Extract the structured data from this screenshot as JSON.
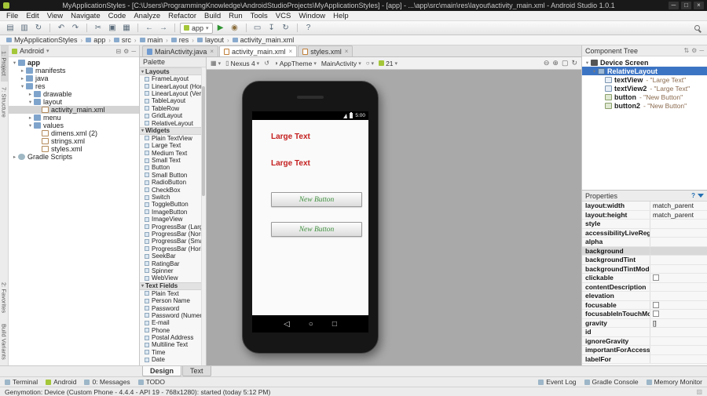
{
  "colors": {
    "accent": "#3c74c4",
    "selection-unfocused": "#d4d4d4",
    "preview-text": "#c41e1e",
    "preview-button-text": "#3f8f3f",
    "canvas": "#a9a9a9"
  },
  "window": {
    "title": "MyApplicationStyles - [C:\\Users\\ProgrammingKnowledge\\AndroidStudioProjects\\MyApplicationStyles] - [app] - ...\\app\\src\\main\\res\\layout\\activity_main.xml - Android Studio 1.0.1"
  },
  "menu_bar": [
    "File",
    "Edit",
    "View",
    "Navigate",
    "Code",
    "Analyze",
    "Refactor",
    "Build",
    "Run",
    "Tools",
    "VCS",
    "Window",
    "Help"
  ],
  "toolbar": {
    "run_config": "app",
    "icons": [
      "open",
      "save",
      "sync",
      "sep",
      "undo",
      "redo",
      "sep",
      "cut",
      "copy",
      "paste",
      "sep",
      "back",
      "forward",
      "sep",
      "run-config",
      "run",
      "debug",
      "sep",
      "avd-manager",
      "sdk-manager",
      "gradle-sync",
      "sep",
      "help"
    ]
  },
  "breadcrumb": [
    "MyApplicationStyles",
    "app",
    "src",
    "main",
    "res",
    "layout",
    "activity_main.xml"
  ],
  "left_stripe": {
    "top": [
      "1: Project",
      "7: Structure"
    ],
    "bottom": [
      "2: Favorites",
      "Build Variants"
    ]
  },
  "project_panel": {
    "view_selector": "Android",
    "tree": [
      {
        "label": "app",
        "depth": 0,
        "arrow": "down",
        "icon": "folder",
        "bold": true
      },
      {
        "label": "manifests",
        "depth": 1,
        "arrow": "right",
        "icon": "folder"
      },
      {
        "label": "java",
        "depth": 1,
        "arrow": "right",
        "icon": "folder"
      },
      {
        "label": "res",
        "depth": 1,
        "arrow": "down",
        "icon": "folder"
      },
      {
        "label": "drawable",
        "depth": 2,
        "arrow": "right",
        "icon": "folder"
      },
      {
        "label": "layout",
        "depth": 2,
        "arrow": "down",
        "icon": "folder"
      },
      {
        "label": "activity_main.xml",
        "depth": 3,
        "icon": "xml",
        "selected": true
      },
      {
        "label": "menu",
        "depth": 2,
        "arrow": "right",
        "icon": "folder"
      },
      {
        "label": "values",
        "depth": 2,
        "arrow": "down",
        "icon": "folder"
      },
      {
        "label": "dimens.xml (2)",
        "depth": 3,
        "icon": "xml"
      },
      {
        "label": "strings.xml",
        "depth": 3,
        "icon": "xml"
      },
      {
        "label": "styles.xml",
        "depth": 3,
        "icon": "xml"
      },
      {
        "label": "Gradle Scripts",
        "depth": 0,
        "arrow": "right",
        "icon": "gradle"
      }
    ]
  },
  "editor_tabs": [
    {
      "label": "MainActivity.java",
      "icon": "java",
      "active": false
    },
    {
      "label": "activity_main.xml",
      "icon": "xml",
      "active": true
    },
    {
      "label": "styles.xml",
      "icon": "xml",
      "active": false
    }
  ],
  "design_toolbar": {
    "device": "Nexus 4",
    "theme": "AppTheme",
    "activity": "MainActivity",
    "api_level": "21"
  },
  "palette": {
    "title": "Palette",
    "sections": [
      {
        "title": "Layouts",
        "items": [
          "FrameLayout",
          "LinearLayout (Horizontal)",
          "LinearLayout (Vertical)",
          "TableLayout",
          "TableRow",
          "GridLayout",
          "RelativeLayout"
        ]
      },
      {
        "title": "Widgets",
        "items": [
          "Plain TextView",
          "Large Text",
          "Medium Text",
          "Small Text",
          "Button",
          "Small Button",
          "RadioButton",
          "CheckBox",
          "Switch",
          "ToggleButton",
          "ImageButton",
          "ImageView",
          "ProgressBar (Large)",
          "ProgressBar (Normal)",
          "ProgressBar (Small)",
          "ProgressBar (Horizontal)",
          "SeekBar",
          "RatingBar",
          "Spinner",
          "WebView"
        ]
      },
      {
        "title": "Text Fields",
        "items": [
          "Plain Text",
          "Person Name",
          "Password",
          "Password (Numeric)",
          "E-mail",
          "Phone",
          "Postal Address",
          "Multiline Text",
          "Time",
          "Date"
        ]
      }
    ]
  },
  "preview": {
    "status_time": "5:00",
    "labels": [
      "Large Text",
      "Large Text"
    ],
    "buttons": [
      "New Button",
      "New Button"
    ]
  },
  "component_tree": {
    "title": "Component Tree",
    "items": [
      {
        "label": "Device Screen",
        "depth": 0,
        "arrow": "down",
        "icon": "device"
      },
      {
        "label": "RelativeLayout",
        "depth": 1,
        "arrow": "down",
        "icon": "layout",
        "selected": true
      },
      {
        "label": "textView",
        "value": "- \"Large Text\"",
        "depth": 2,
        "icon": "textview"
      },
      {
        "label": "textView2",
        "value": "- \"Large Text\"",
        "depth": 2,
        "icon": "textview"
      },
      {
        "label": "button",
        "value": "- \"New Button\"",
        "depth": 2,
        "icon": "button"
      },
      {
        "label": "button2",
        "value": "- \"New Button\"",
        "depth": 2,
        "icon": "button"
      }
    ]
  },
  "properties": {
    "title": "Properties",
    "rows": [
      {
        "name": "layout:width",
        "value": "match_parent"
      },
      {
        "name": "layout:height",
        "value": "match_parent"
      },
      {
        "name": "style",
        "value": ""
      },
      {
        "name": "accessibilityLiveRegion",
        "value": ""
      },
      {
        "name": "alpha",
        "value": ""
      },
      {
        "name": "background",
        "value": "",
        "highlight": true
      },
      {
        "name": "backgroundTint",
        "value": ""
      },
      {
        "name": "backgroundTintMode",
        "value": ""
      },
      {
        "name": "clickable",
        "control": "checkbox"
      },
      {
        "name": "contentDescription",
        "value": ""
      },
      {
        "name": "elevation",
        "value": ""
      },
      {
        "name": "focusable",
        "control": "checkbox"
      },
      {
        "name": "focusableInTouchMode",
        "control": "checkbox"
      },
      {
        "name": "gravity",
        "value": "[]"
      },
      {
        "name": "id",
        "value": ""
      },
      {
        "name": "ignoreGravity",
        "value": ""
      },
      {
        "name": "importantForAccessibility",
        "value": ""
      },
      {
        "name": "labelFor",
        "value": ""
      }
    ]
  },
  "editor_bottom_tabs": [
    {
      "label": "Design",
      "active": true
    },
    {
      "label": "Text",
      "active": false
    }
  ],
  "tool_window_bar": {
    "left": [
      "Terminal",
      "Android",
      "0: Messages",
      "TODO"
    ],
    "right": [
      "Event Log",
      "Gradle Console",
      "Memory Monitor"
    ]
  },
  "status_bar": {
    "message": "Genymotion: Device (Custom Phone - 4.4.4 - API 19 - 768x1280): started (today 5:12 PM)"
  }
}
